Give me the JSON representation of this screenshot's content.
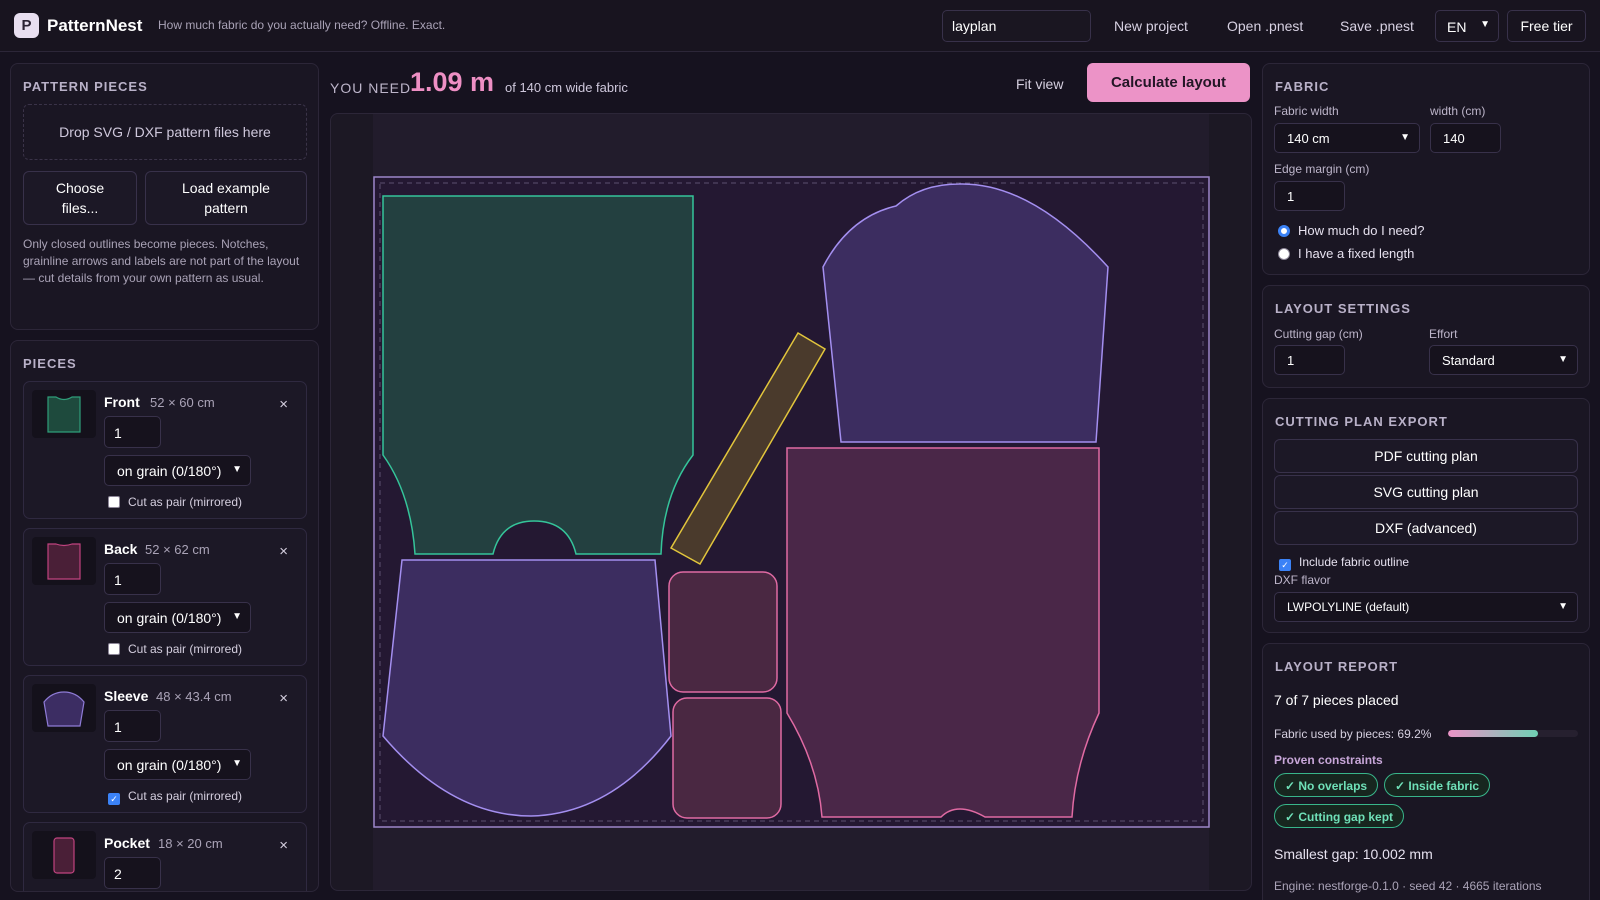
{
  "app": {
    "brand": "PatternNest",
    "logo_letter": "P",
    "tagline": "How much fabric do you actually need? Offline. Exact.",
    "search_value": "layplan",
    "nav": [
      "New project",
      "Open .pnest",
      "Save .pnest"
    ],
    "language": "EN",
    "tier": "Free tier"
  },
  "left": {
    "patterns_title": "PATTERN PIECES",
    "drop_text": "Drop SVG / DXF pattern files here",
    "choose_btn": "Choose files...",
    "example_btn": "Load example pattern",
    "note": "Only closed outlines become pieces. Notches, grainline arrows and labels are not part of the layout — cut details from your own pattern as usual.",
    "pieces_title": "PIECES",
    "close_glyph": "×",
    "pair_label": "Cut as pair (mirrored)",
    "pieces": [
      {
        "name": "Front",
        "dims": "52 × 60 cm",
        "qty": "1",
        "grain": "on grain (0/180°)",
        "pair": false,
        "color": "#2f9e7a"
      },
      {
        "name": "Back",
        "dims": "52 × 62 cm",
        "qty": "1",
        "grain": "on grain (0/180°)",
        "pair": false,
        "color": "#c0437f"
      },
      {
        "name": "Sleeve",
        "dims": "48 × 43.4 cm",
        "qty": "1",
        "grain": "on grain (0/180°)",
        "pair": true,
        "color": "#8e7bd6"
      },
      {
        "name": "Pocket",
        "dims": "18 × 20 cm",
        "qty": "2",
        "color": "#c0437f"
      }
    ]
  },
  "center": {
    "you_need": "YOU NEED",
    "meters": "1.09 m",
    "sub": "of 140 cm wide fabric",
    "fit_view": "Fit view",
    "calculate": "Calculate layout"
  },
  "right": {
    "fabric_title": "FABRIC",
    "fabric_width_label": "Fabric width",
    "fabric_width_value": "140 cm",
    "width_cm_label": "width (cm)",
    "width_cm_value": "140",
    "edge_margin_label": "Edge margin (cm)",
    "edge_margin_value": "1",
    "mode_need": "How much do I need?",
    "mode_fixed": "I have a fixed length",
    "layout_title": "LAYOUT SETTINGS",
    "gap_label": "Cutting gap (cm)",
    "gap_value": "1",
    "effort_label": "Effort",
    "effort_value": "Standard",
    "export_title": "CUTTING PLAN EXPORT",
    "pdf": "PDF cutting plan",
    "svg": "SVG cutting plan",
    "dxf": "DXF (advanced)",
    "include_outline": "Include fabric outline",
    "dxf_flavor_label": "DXF flavor",
    "dxf_flavor_value": "LWPOLYLINE (default)",
    "report_title": "LAYOUT REPORT",
    "placed": "7 of 7 pieces placed",
    "usage": "Fabric used by pieces: 69.2%",
    "usage_fraction": 0.692,
    "proven": "Proven constraints",
    "badges": [
      "✓ No overlaps",
      "✓ Inside fabric",
      "✓ Cutting gap kept"
    ],
    "smallest_gap": "Smallest gap: 10.002 mm",
    "engine": "Engine: nestforge-0.1.0 · seed 42 · 4665 iterations"
  },
  "colors": {
    "accent": "#ec93c7",
    "front": "#2f9e7a",
    "sleeve": "#8e7bd6",
    "back": "#c0437f",
    "strip": "#d9b33a",
    "success": "#38b58a"
  }
}
